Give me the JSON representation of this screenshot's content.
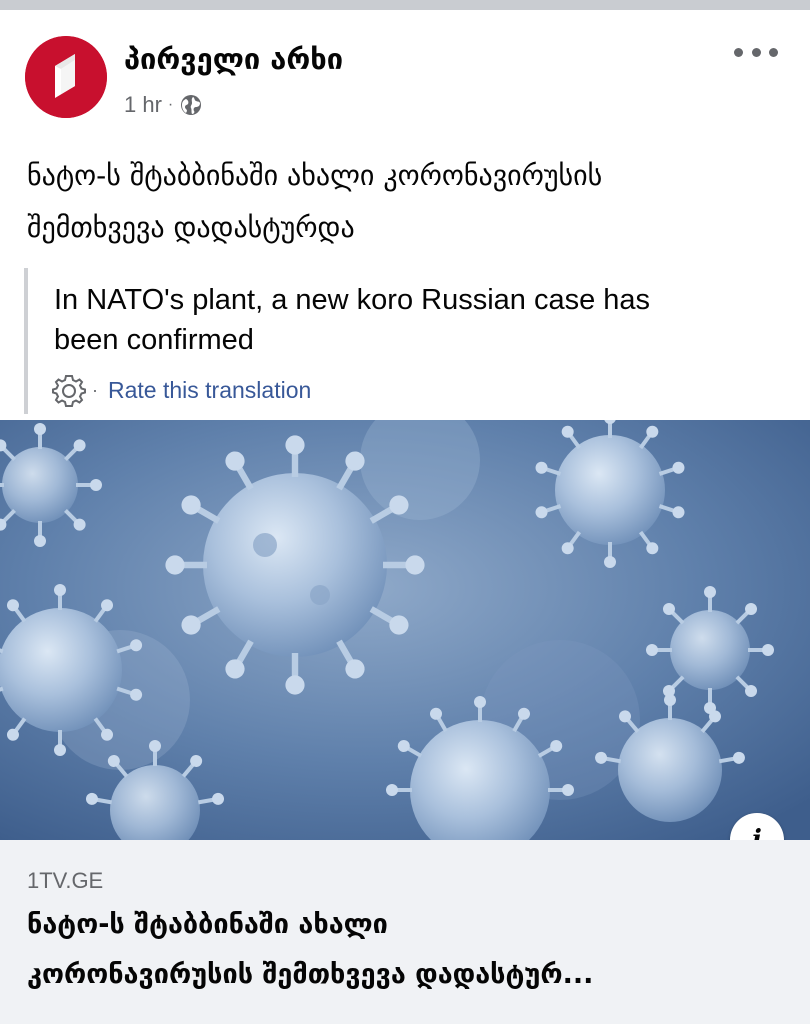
{
  "post": {
    "page_name": "პირველი არხი",
    "time": "1 hr",
    "separator": "·",
    "audience_icon": "globe-icon",
    "more_icon": "more-horizontal-icon",
    "text_line1": "ნატო-ს შტაბბინაში ახალი კორონავირუსის",
    "text_line2": "შემთხვევა დადასტურდა"
  },
  "translation": {
    "text_line1": "In NATO's plant, a new koro Russian case has",
    "text_line2": "been confirmed",
    "settings_icon": "gear-icon",
    "separator": "·",
    "rate_label": "Rate this translation"
  },
  "media": {
    "image_subject": "coronavirus",
    "info_icon": "info-icon",
    "info_label": "i"
  },
  "link_preview": {
    "domain": "1TV.GE",
    "title_line1": "ნატო-ს შტაბბინაში ახალი",
    "title_line2": "კორონავირუსის შემთხვევა დადასტურ..."
  },
  "colors": {
    "brand_red": "#c8102e",
    "link_blue": "#385898",
    "secondary_text": "#65676b",
    "preview_bg": "#f0f2f5"
  }
}
